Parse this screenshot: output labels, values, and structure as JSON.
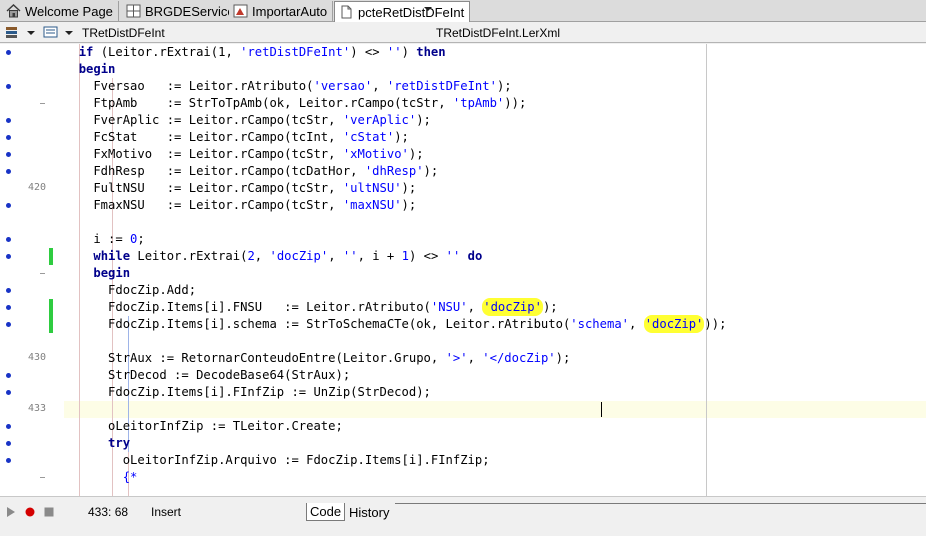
{
  "tabs": [
    {
      "label": "Welcome Page",
      "icon": "home-icon"
    },
    {
      "label": "BRGDEService",
      "icon": "grid-icon"
    },
    {
      "label": "ImportarAuto",
      "icon": "form-icon"
    },
    {
      "label": "pcteRetDistDFeInt",
      "icon": "unit-file-icon",
      "active": true
    }
  ],
  "nav": {
    "class_dropdown": "TRetDistDFeInt",
    "method_dropdown": "TRetDistDFeInt.LerXml"
  },
  "code_lines": [
    [
      {
        "t": "  "
      },
      {
        "t": "if",
        "c": "kw"
      },
      {
        "t": " (Leitor.rExtrai(1, "
      },
      {
        "t": "'retDistDFeInt'",
        "c": "str"
      },
      {
        "t": ") <> "
      },
      {
        "t": "''",
        "c": "str"
      },
      {
        "t": ") "
      },
      {
        "t": "then",
        "c": "kw"
      }
    ],
    [
      {
        "t": "  "
      },
      {
        "t": "begin",
        "c": "kw"
      }
    ],
    [
      {
        "t": "    Fversao   := Leitor.rAtributo("
      },
      {
        "t": "'versao'",
        "c": "str"
      },
      {
        "t": ", "
      },
      {
        "t": "'retDistDFeInt'",
        "c": "str"
      },
      {
        "t": ");"
      }
    ],
    [
      {
        "t": "    FtpAmb    := StrToTpAmb(ok, Leitor.rCampo(tcStr, "
      },
      {
        "t": "'tpAmb'",
        "c": "str"
      },
      {
        "t": "));"
      }
    ],
    [
      {
        "t": "    FverAplic := Leitor.rCampo(tcStr, "
      },
      {
        "t": "'verAplic'",
        "c": "str"
      },
      {
        "t": ");"
      }
    ],
    [
      {
        "t": "    FcStat    := Leitor.rCampo(tcInt, "
      },
      {
        "t": "'cStat'",
        "c": "str"
      },
      {
        "t": ");"
      }
    ],
    [
      {
        "t": "    FxMotivo  := Leitor.rCampo(tcStr, "
      },
      {
        "t": "'xMotivo'",
        "c": "str"
      },
      {
        "t": ");"
      }
    ],
    [
      {
        "t": "    FdhResp   := Leitor.rCampo(tcDatHor, "
      },
      {
        "t": "'dhResp'",
        "c": "str"
      },
      {
        "t": ");"
      }
    ],
    [
      {
        "t": "    FultNSU   := Leitor.rCampo(tcStr, "
      },
      {
        "t": "'ultNSU'",
        "c": "str"
      },
      {
        "t": ");"
      }
    ],
    [
      {
        "t": "    FmaxNSU   := Leitor.rCampo(tcStr, "
      },
      {
        "t": "'maxNSU'",
        "c": "str"
      },
      {
        "t": ");"
      }
    ],
    [],
    [
      {
        "t": "    i := "
      },
      {
        "t": "0",
        "c": "str"
      },
      {
        "t": ";"
      }
    ],
    [
      {
        "t": "    "
      },
      {
        "t": "while",
        "c": "kw"
      },
      {
        "t": " Leitor.rExtrai("
      },
      {
        "t": "2",
        "c": "str"
      },
      {
        "t": ", "
      },
      {
        "t": "'docZip'",
        "c": "str"
      },
      {
        "t": ", "
      },
      {
        "t": "''",
        "c": "str"
      },
      {
        "t": ", i + "
      },
      {
        "t": "1",
        "c": "str"
      },
      {
        "t": ") <> "
      },
      {
        "t": "''",
        "c": "str"
      },
      {
        "t": " "
      },
      {
        "t": "do",
        "c": "kw"
      }
    ],
    [
      {
        "t": "    "
      },
      {
        "t": "begin",
        "c": "kw"
      }
    ],
    [
      {
        "t": "      FdocZip.Add;"
      }
    ],
    [
      {
        "t": "      FdocZip.Items[i].FNSU   := Leitor.rAtributo("
      },
      {
        "t": "'NSU'",
        "c": "str"
      },
      {
        "t": ", "
      },
      {
        "t": "'docZip'",
        "c": "str hl"
      },
      {
        "t": ");"
      }
    ],
    [
      {
        "t": "      FdocZip.Items[i].schema := StrToSchemaCTe(ok, Leitor.rAtributo("
      },
      {
        "t": "'schema'",
        "c": "str"
      },
      {
        "t": ", "
      },
      {
        "t": "'docZip'",
        "c": "str hl"
      },
      {
        "t": "));"
      }
    ],
    [],
    [
      {
        "t": "      StrAux := RetornarConteudoEntre(Leitor.Grupo, "
      },
      {
        "t": "'>'",
        "c": "str"
      },
      {
        "t": ", "
      },
      {
        "t": "'</docZip'",
        "c": "str"
      },
      {
        "t": ");"
      }
    ],
    [
      {
        "t": "      StrDecod := DecodeBase64(StrAux);"
      }
    ],
    [
      {
        "t": "      FdocZip.Items[i].FInfZip := UnZip(StrDecod);"
      }
    ],
    [],
    [
      {
        "t": "      oLeitorInfZip := TLeitor.Create;"
      }
    ],
    [
      {
        "t": "      "
      },
      {
        "t": "try",
        "c": "kw"
      }
    ],
    [
      {
        "t": "        oLeitorInfZip.Arquivo := FdocZip.Items[i].FInfZip;"
      }
    ],
    [
      {
        "t": "        "
      },
      {
        "t": "{*",
        "c": "str"
      }
    ]
  ],
  "gutter": [
    {
      "marker": "dot"
    },
    {
      "marker": "none"
    },
    {
      "marker": "dot"
    },
    {
      "marker": "dash"
    },
    {
      "marker": "dot"
    },
    {
      "marker": "dot"
    },
    {
      "marker": "dot"
    },
    {
      "marker": "dot"
    },
    {
      "marker": "num",
      "label": "420"
    },
    {
      "marker": "dot"
    },
    {
      "marker": "none"
    },
    {
      "marker": "dot"
    },
    {
      "marker": "dot",
      "changed": true
    },
    {
      "marker": "dash"
    },
    {
      "marker": "dot"
    },
    {
      "marker": "dot",
      "changed": true
    },
    {
      "marker": "dot",
      "changed": true
    },
    {
      "marker": "none"
    },
    {
      "marker": "num",
      "label": "430"
    },
    {
      "marker": "dot"
    },
    {
      "marker": "dot"
    },
    {
      "marker": "num",
      "label": "433"
    },
    {
      "marker": "dot"
    },
    {
      "marker": "dot"
    },
    {
      "marker": "dot"
    },
    {
      "marker": "dash"
    }
  ],
  "status": {
    "position": "433:  68",
    "mode": "Insert",
    "view_tabs": [
      "Code",
      "History"
    ],
    "active_view": "Code"
  },
  "colors": {
    "keyword": "#00008b",
    "string": "#0000ff",
    "highlight": "#ffff33",
    "current_line": "#fdfde6",
    "change_bar": "#2ecc40",
    "breakpoint_dot": "#1833c6"
  }
}
